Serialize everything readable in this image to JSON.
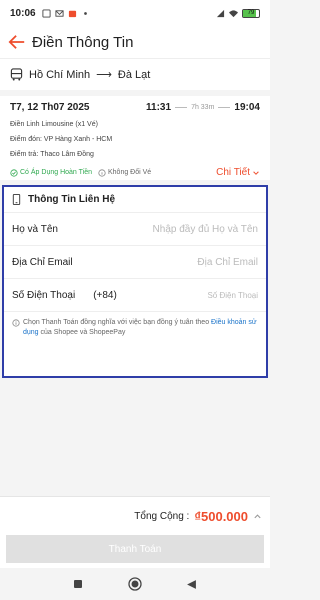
{
  "status_bar": {
    "time": "10:06",
    "battery": "79"
  },
  "header": {
    "title": "Điền Thông Tin"
  },
  "route": {
    "origin": "Hồ Chí Minh",
    "arrow": "⟶",
    "destination": "Đà Lạt"
  },
  "trip": {
    "date": "T7, 12 Th07 2025",
    "depart": "11:31",
    "duration": "7h 33m",
    "arrive": "19:04",
    "operator": "Điền Linh Limousine (x1 Vé)",
    "pickup": "Điểm đón: VP Hàng Xanh - HCM",
    "dropoff": "Điểm trả: Thaco Lâm Đồng",
    "refund_label": "Có Áp Dụng Hoàn Tiền",
    "no_change_label": "Không Đổi Vé",
    "detail_link": "Chi Tiết"
  },
  "contact": {
    "title": "Thông Tin Liên Hệ",
    "name_label": "Họ và Tên",
    "name_placeholder": "Nhập đầy đủ Họ và Tên",
    "email_label": "Địa Chỉ Email",
    "email_placeholder": "Địa Chỉ Email",
    "phone_label": "Số Điện Thoại",
    "country_code": "(+84)",
    "phone_placeholder": "Số Điện Thoại",
    "terms_prefix": "Chọn Thanh Toán đồng nghĩa với việc bạn đồng ý tuân theo ",
    "terms_link": "Điều khoản sử dụng",
    "terms_suffix": " của Shopee và ShopeePay"
  },
  "footer": {
    "total_label": "Tổng Cộng :",
    "total_amount": "₫500.000",
    "pay_button": "Thanh Toán"
  },
  "colors": {
    "accent": "#ee4d2d",
    "highlight_border": "#2f3ea8",
    "success": "#2fa84f",
    "link": "#1a73c9"
  }
}
